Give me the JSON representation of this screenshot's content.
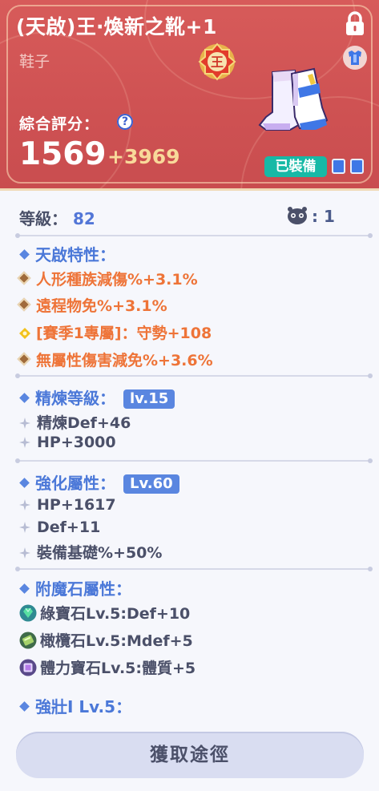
{
  "item": {
    "title": "(天啟)王‧煥新之靴+1",
    "type": "鞋子",
    "emblem_char": "王",
    "score_label": "綜合評分：",
    "score_value": "1569",
    "score_bonus": "+3969",
    "equipped_label": "已裝備"
  },
  "level": {
    "label": "等級：",
    "value": "82",
    "pet_count": ": 1"
  },
  "sections": {
    "awaken": {
      "title": "天啟特性：",
      "lines": [
        "人形種族減傷%+3.1%",
        "遠程物免%+3.1%",
        "[賽季1專屬]：守勢+108",
        "無屬性傷害減免%+3.6%"
      ]
    },
    "refine": {
      "title": "精煉等級：",
      "chip": "lv.15",
      "lines": [
        "精煉Def+46",
        "HP+3000"
      ]
    },
    "enhance": {
      "title": "強化屬性：",
      "chip": "Lv.60",
      "lines": [
        "HP+1617",
        "Def+11",
        "裝備基礎%+50%"
      ]
    },
    "enchant": {
      "title": "附魔石屬性：",
      "lines": [
        "綠寶石Lv.5:Def+10",
        "橄欖石Lv.5:Mdef+5",
        "體力寶石Lv.5:體質+5"
      ]
    },
    "sturdy": {
      "title": "強壯I Lv.5："
    }
  },
  "button": {
    "get_source": "獲取途徑"
  },
  "icons": {
    "lock": "lock-icon",
    "armor": "armor-icon",
    "help": "help-icon",
    "pet": "pet-icon",
    "green_gem": "green-gem-icon",
    "olive_gem": "olive-gem-icon",
    "vitality_gem": "vitality-gem-icon"
  },
  "colors": {
    "header": "#d05454",
    "accent": "#5a86e0",
    "orange": "#ee7438",
    "teal": "#17b9a6"
  }
}
